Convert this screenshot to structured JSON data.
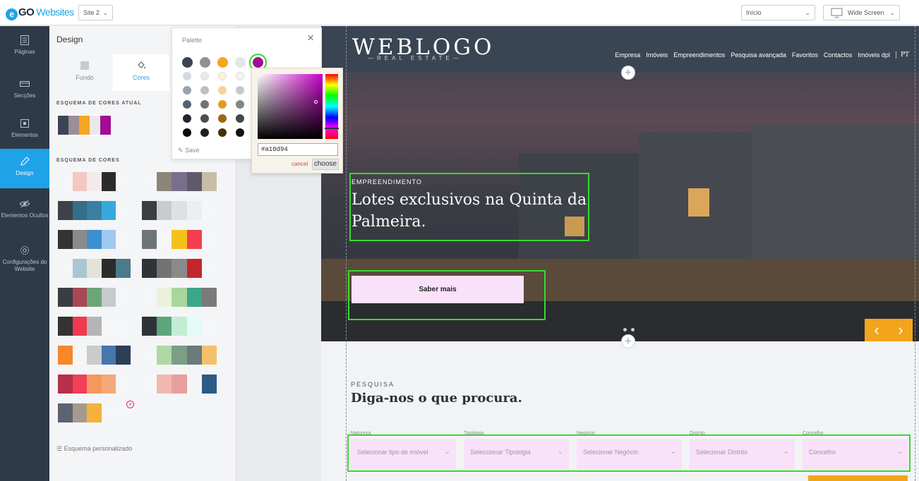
{
  "topbar": {
    "brand_e": "e",
    "brand_go": "GO",
    "brand_websites": "Websites",
    "site_select": "Site 2",
    "page_select": "Início",
    "view_select": "Wide Screen"
  },
  "leftnav": {
    "items": [
      {
        "label": "Páginas",
        "icon": "pages-icon"
      },
      {
        "label": "Secções",
        "icon": "sections-icon"
      },
      {
        "label": "Elementos",
        "icon": "elements-icon"
      },
      {
        "label": "Design",
        "icon": "pencil-icon",
        "active": true
      },
      {
        "label": "Elementos Ocultos",
        "icon": "eye-hidden-icon"
      },
      {
        "label": "Configurações do Website",
        "icon": "gear-icon"
      }
    ]
  },
  "panel": {
    "title": "Design",
    "tabs": [
      {
        "label": "Fundo",
        "icon": "background-icon"
      },
      {
        "label": "Cores",
        "icon": "paint-bucket-icon",
        "active": true
      }
    ],
    "current_scheme_label": "ESQUEMA DE CORES ATUAL",
    "current_scheme": [
      "#3a4454",
      "#9a8f95",
      "#f5a623",
      "#e9e9ea",
      "#a10d94"
    ],
    "schemes_label": "ESQUEMA DE CORES",
    "schemes": [
      [
        "#f5f6f7",
        "#f4c8c0",
        "#f4eaea",
        "#2b2b2b",
        "#f5f6f7"
      ],
      [
        "#f5f6f7",
        "#8c8579",
        "#7a6f8a",
        "#5e5a6a",
        "#c7bda8"
      ],
      [
        "#3e4148",
        "#356e87",
        "#3a7fa2",
        "#38a8dc",
        "#f5f6f7"
      ],
      [
        "#3a3d42",
        "#c8ccd0",
        "#dde1e4",
        "#eceeef",
        "#f5f6f7"
      ],
      [
        "#333333",
        "#8a8a8a",
        "#3e8ed0",
        "#9ec9f0",
        "#f5f6f7"
      ],
      [
        "#6e7577",
        "#f5f6f7",
        "#f5c21c",
        "#f0404e",
        "#f5f6f7"
      ],
      [
        "#f5f6f7",
        "#a8c7d3",
        "#e6e2d8",
        "#2b2b2b",
        "#4b7a8c"
      ],
      [
        "#2f3338",
        "#727272",
        "#8a8a8a",
        "#c3272d",
        "#f5f6f7"
      ],
      [
        "#3a3d42",
        "#a84857",
        "#6aa678",
        "#c7c9cc",
        "#f5f6f7"
      ],
      [
        "#f5f6f7",
        "#eaf2dc",
        "#a8d69c",
        "#3da58a",
        "#7a7a7a"
      ],
      [
        "#333333",
        "#f0384e",
        "#b5b5b5",
        "#f5f6f7",
        "#f5f6f7"
      ],
      [
        "#2f3338",
        "#5da57a",
        "#c4ecd5",
        "#e4fbf6",
        "#f5f6f7"
      ],
      [
        "#f5882b",
        "#f5f6f7",
        "#cbcbcb",
        "#4676ad",
        "#2c3e57"
      ],
      [
        "#f5f6f7",
        "#aed9a6",
        "#7a9e86",
        "#6b7a7a",
        "#f5c06a"
      ],
      [
        "#b8304a",
        "#f0405a",
        "#f5985e",
        "#f5a978",
        "#f5f6f7"
      ],
      [
        "#f5f6f7",
        "#f2b8b0",
        "#e8a09e",
        "#f5f6f7",
        "#2c5c86"
      ],
      [
        "#5d6370",
        "#a69a8e",
        "#f5b13b",
        "#f5f6f7",
        "#f5f6f7"
      ]
    ],
    "custom_label": "Esquema personalizado"
  },
  "palette": {
    "title": "Palette",
    "save_label": "Save",
    "selected": "#a10d94",
    "rows": [
      [
        "#3a4454",
        "#968d92",
        "#f5a623",
        "#e5e6e7",
        "#a10d94"
      ],
      [
        "#d6d9dd",
        "#eae8e9",
        "#fdf0dc",
        "#f3f3f4"
      ],
      [
        "#9aa3b2",
        "#c3bdbf",
        "#fad19b",
        "#c8c9cb"
      ],
      [
        "#556275",
        "#787174",
        "#e59c1e",
        "#838486"
      ],
      [
        "#1f262f",
        "#514a4e",
        "#9c6713",
        "#454647"
      ],
      [
        "#080a0d",
        "#221e20",
        "#473007",
        "#121213"
      ]
    ]
  },
  "picker": {
    "hex_value": "#a10d94",
    "cancel_label": "cancel",
    "choose_label": "choose"
  },
  "site": {
    "logo": "WEBLOGO",
    "logo_sub": "—REAL ESTATE—",
    "menu": [
      "Empresa",
      "Imóveis",
      "Empreendimentos",
      "Pesquisa avançada",
      "Favoritos",
      "Contactos",
      "Imóveis dpl"
    ],
    "lang": "PT",
    "hero_kicker": "EMPREENDIMENTO",
    "hero_title": "Lotes exclusivos na Quinta da Palmeira.",
    "hero_button": "Saber mais",
    "search_kicker": "PESQUISA",
    "search_title": "Diga-nos o que procura.",
    "filters": [
      {
        "label": "Natureza",
        "placeholder": "Selecionar tipo de imóvel"
      },
      {
        "label": "Tipologia",
        "placeholder": "Seleccionar Tipologia"
      },
      {
        "label": "Negócio",
        "placeholder": "Selecionar Negócio"
      },
      {
        "label": "Distrito",
        "placeholder": "Selecionar Distrito"
      },
      {
        "label": "Concelho",
        "placeholder": "Concelho"
      }
    ],
    "accent": "#f2a51a",
    "highlight": "#39d92f"
  }
}
